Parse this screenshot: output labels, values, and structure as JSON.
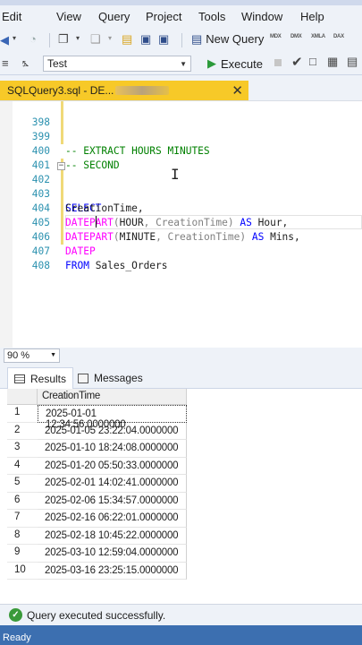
{
  "menubar": {
    "items": [
      "Edit",
      "View",
      "Query",
      "Project",
      "Tools",
      "Window",
      "Help"
    ]
  },
  "toolbar": {
    "new_query_label": "New Query",
    "mini_buttons": [
      "MDX",
      "DMX",
      "XMLA",
      "DAX"
    ]
  },
  "toolbar2": {
    "database": "Test",
    "execute_label": "Execute"
  },
  "document_tab": {
    "title": "SQLQuery3.sql - DE..."
  },
  "editor": {
    "lines": [
      {
        "num": "398",
        "text": ""
      },
      {
        "num": "399",
        "text": "-- EXTRACT HOURS MINUTES"
      },
      {
        "num": "400",
        "text": "-- SECOND"
      },
      {
        "num": "401",
        "text": ""
      },
      {
        "num": "402",
        "text": "SELECT"
      },
      {
        "num": "403",
        "text": "CreationTime,"
      },
      {
        "num": "404",
        "text": "DATEPART(HOUR, CreationTime) AS Hour,"
      },
      {
        "num": "405",
        "text": "DATEPART(MINUTE, CreationTime) AS Mins,"
      },
      {
        "num": "406",
        "text": "DATEP"
      },
      {
        "num": "407",
        "text": "FROM Sales_Orders"
      },
      {
        "num": "408",
        "text": ""
      }
    ],
    "tokens": {
      "c399": "-- EXTRACT HOURS MINUTES",
      "c400": "-- SECOND",
      "select": "SELECT",
      "creation_time_line": "CreationTime,",
      "datepart": "DATEPART",
      "paren_open": "(",
      "hour": "HOUR",
      "minute": "MINUTE",
      "comma_ct": ", CreationTime",
      "paren_close": ")",
      "as": "AS",
      "hour_alias": " Hour,",
      "mins_alias": " Mins,",
      "datep": "DATEP",
      "from": "FROM",
      "table": " Sales_Orders"
    }
  },
  "zoom": "90 %",
  "result_tabs": {
    "results": "Results",
    "messages": "Messages"
  },
  "grid": {
    "column": "CreationTime",
    "rows": [
      {
        "n": "1",
        "v": "2025-01-01 12:34:56.0000000"
      },
      {
        "n": "2",
        "v": "2025-01-05 23:22:04.0000000"
      },
      {
        "n": "3",
        "v": "2025-01-10 18:24:08.0000000"
      },
      {
        "n": "4",
        "v": "2025-01-20 05:50:33.0000000"
      },
      {
        "n": "5",
        "v": "2025-02-01 14:02:41.0000000"
      },
      {
        "n": "6",
        "v": "2025-02-06 15:34:57.0000000"
      },
      {
        "n": "7",
        "v": "2025-02-16 06:22:01.0000000"
      },
      {
        "n": "8",
        "v": "2025-02-18 10:45:22.0000000"
      },
      {
        "n": "9",
        "v": "2025-03-10 12:59:04.0000000"
      },
      {
        "n": "10",
        "v": "2025-03-16 23:25:15.0000000"
      }
    ]
  },
  "query_status": "Query executed successfully.",
  "app_status": "Ready",
  "colors": {
    "tab_accent": "#f7c928",
    "keyword": "#0000ff",
    "function": "#ff00ff",
    "comment": "#008000",
    "line_number": "#2b91af",
    "status_bar": "#3c6fb0"
  }
}
